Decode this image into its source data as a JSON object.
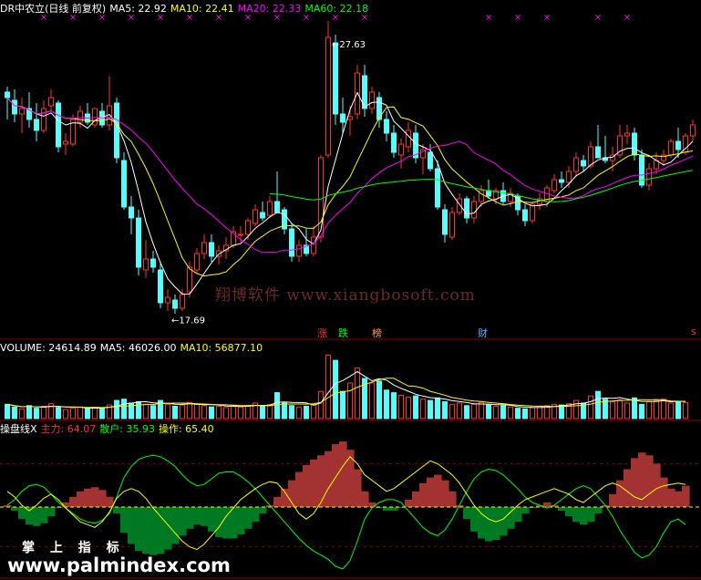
{
  "header": {
    "title": "DR中农立(日线 前复权)",
    "ma5": "MA5: 22.92",
    "ma10": "MA10: 22.41",
    "ma20": "MA20: 22.33",
    "ma60": "MA60: 22.18"
  },
  "volume_header": {
    "label": "VOLUME: 24614.89",
    "ma5": "MA5: 46026.00",
    "ma10": "MA10: 56877.10"
  },
  "indicator_header": {
    "label": "操盘线X",
    "main": "主力: 64.07",
    "retail": "散户: 35.93",
    "operate": "操作: 65.40"
  },
  "annotations": {
    "high": "27.63",
    "low": "17.69",
    "zhang": "涨",
    "die": "跌",
    "bang": "榜",
    "cai": "财",
    "s": "s"
  },
  "watermarks": {
    "center": "翔博软件 www.xiangbosoft.com",
    "brand": "掌 上 指 标",
    "site": "www.palmindex.com"
  },
  "colors": {
    "up": "#ff3232",
    "down": "#54ffff",
    "ma5": "#ffffff",
    "ma10": "#ffff00",
    "ma20": "#ff00ff",
    "ma60": "#00ff00",
    "retail_line": "#00ff00",
    "operate_line": "#ffff00",
    "main_fill_pos": "#a33232",
    "main_fill_neg": "#007a22"
  },
  "chart_data": [
    {
      "type": "candlestick",
      "title": "DR中农立(日线 前复权)",
      "ylim": [
        17,
        28.5
      ],
      "annotations": [
        {
          "label": "27.63",
          "value": 27.63
        },
        {
          "label": "17.69",
          "value": 17.69
        }
      ],
      "candles": [
        [
          25.8,
          26.0,
          24.8,
          25.6
        ],
        [
          25.5,
          25.9,
          24.7,
          25.0
        ],
        [
          25.0,
          25.6,
          24.3,
          25.2
        ],
        [
          25.2,
          25.8,
          24.5,
          24.8
        ],
        [
          24.8,
          25.4,
          24.0,
          24.4
        ],
        [
          24.4,
          25.5,
          24.3,
          25.2
        ],
        [
          25.3,
          25.9,
          25.1,
          25.6
        ],
        [
          25.4,
          25.5,
          23.6,
          23.8
        ],
        [
          23.9,
          24.3,
          23.5,
          24.0
        ],
        [
          23.9,
          25.0,
          23.8,
          24.8
        ],
        [
          24.7,
          25.3,
          24.5,
          25.1
        ],
        [
          25.0,
          25.4,
          24.6,
          24.7
        ],
        [
          24.6,
          25.2,
          24.5,
          25.2
        ],
        [
          25.1,
          25.4,
          24.5,
          24.6
        ],
        [
          24.6,
          26.4,
          24.4,
          25.3
        ],
        [
          25.4,
          25.6,
          23.2,
          23.4
        ],
        [
          23.3,
          23.6,
          21.5,
          21.6
        ],
        [
          21.6,
          22.0,
          20.6,
          21.2
        ],
        [
          21.2,
          21.5,
          19.1,
          19.4
        ],
        [
          19.3,
          20.4,
          19.0,
          19.7
        ],
        [
          19.7,
          20.0,
          19.2,
          19.4
        ],
        [
          19.3,
          19.6,
          17.9,
          18.1
        ],
        [
          18.1,
          18.6,
          17.8,
          18.3
        ],
        [
          18.2,
          18.4,
          17.7,
          17.9
        ],
        [
          17.9,
          18.6,
          17.8,
          18.4
        ],
        [
          18.5,
          19.6,
          18.3,
          19.4
        ],
        [
          19.3,
          20.1,
          19.2,
          19.9
        ],
        [
          19.9,
          20.6,
          19.7,
          20.3
        ],
        [
          20.3,
          20.6,
          19.6,
          19.8
        ],
        [
          19.8,
          20.2,
          19.5,
          20.0
        ],
        [
          20.0,
          20.5,
          19.7,
          20.2
        ],
        [
          20.2,
          20.9,
          20.1,
          20.7
        ],
        [
          20.6,
          20.9,
          20.3,
          20.6
        ],
        [
          20.6,
          21.2,
          20.4,
          21.1
        ],
        [
          21.0,
          21.7,
          20.9,
          21.5
        ],
        [
          21.4,
          21.8,
          21.1,
          21.2
        ],
        [
          21.3,
          22.0,
          21.2,
          21.8
        ],
        [
          21.8,
          22.9,
          21.5,
          21.4
        ],
        [
          21.5,
          21.6,
          20.6,
          20.8
        ],
        [
          20.8,
          21.0,
          19.6,
          19.8
        ],
        [
          19.8,
          20.4,
          19.6,
          20.2
        ],
        [
          20.2,
          20.8,
          19.8,
          19.9
        ],
        [
          19.9,
          20.9,
          19.8,
          20.5
        ],
        [
          20.5,
          23.5,
          20.3,
          23.4
        ],
        [
          23.5,
          28.4,
          23.4,
          27.8
        ],
        [
          27.6,
          27.9,
          24.6,
          25.0
        ],
        [
          25.0,
          25.6,
          24.3,
          24.7
        ],
        [
          24.8,
          25.3,
          24.2,
          24.9
        ],
        [
          25.0,
          26.8,
          24.8,
          26.5
        ],
        [
          26.4,
          26.8,
          24.9,
          25.2
        ],
        [
          25.2,
          26.0,
          25.0,
          25.8
        ],
        [
          25.6,
          25.8,
          24.5,
          24.8
        ],
        [
          24.8,
          25.1,
          24.0,
          24.3
        ],
        [
          24.3,
          24.6,
          23.4,
          23.6
        ],
        [
          23.5,
          24.1,
          23.0,
          23.9
        ],
        [
          23.8,
          24.7,
          23.6,
          24.4
        ],
        [
          24.3,
          24.6,
          23.2,
          23.4
        ],
        [
          23.4,
          23.9,
          22.8,
          23.7
        ],
        [
          23.6,
          23.9,
          22.9,
          23.0
        ],
        [
          23.0,
          23.3,
          21.5,
          21.6
        ],
        [
          21.5,
          21.7,
          20.3,
          20.6
        ],
        [
          20.5,
          21.6,
          20.4,
          21.4
        ],
        [
          21.4,
          22.1,
          21.3,
          21.9
        ],
        [
          21.9,
          22.0,
          21.0,
          21.2
        ],
        [
          21.2,
          22.0,
          21.0,
          21.8
        ],
        [
          21.8,
          22.4,
          21.6,
          22.2
        ],
        [
          22.2,
          22.6,
          21.9,
          22.0
        ],
        [
          21.9,
          22.3,
          21.7,
          22.2
        ],
        [
          22.2,
          22.5,
          21.7,
          21.8
        ],
        [
          21.8,
          22.3,
          21.6,
          22.1
        ],
        [
          22.0,
          22.1,
          21.3,
          21.5
        ],
        [
          21.5,
          21.7,
          20.9,
          21.1
        ],
        [
          21.1,
          21.8,
          21.0,
          21.7
        ],
        [
          21.7,
          22.1,
          21.5,
          21.9
        ],
        [
          21.8,
          22.4,
          21.6,
          22.3
        ],
        [
          22.2,
          22.8,
          22.1,
          22.6
        ],
        [
          22.6,
          22.9,
          22.3,
          22.5
        ],
        [
          22.5,
          23.1,
          22.3,
          22.9
        ],
        [
          22.9,
          23.6,
          22.7,
          23.4
        ],
        [
          23.3,
          23.5,
          22.9,
          23.1
        ],
        [
          23.1,
          24.0,
          23.0,
          23.8
        ],
        [
          23.8,
          24.6,
          23.6,
          23.4
        ],
        [
          23.4,
          24.2,
          23.2,
          23.3
        ],
        [
          23.3,
          23.8,
          22.9,
          23.5
        ],
        [
          23.5,
          24.6,
          23.4,
          24.2
        ],
        [
          24.2,
          24.6,
          23.9,
          24.3
        ],
        [
          24.3,
          24.5,
          23.3,
          23.5
        ],
        [
          23.5,
          23.7,
          22.3,
          22.4
        ],
        [
          22.4,
          23.2,
          22.2,
          23.0
        ],
        [
          23.0,
          23.6,
          22.8,
          23.3
        ],
        [
          23.3,
          23.7,
          23.1,
          23.5
        ],
        [
          23.5,
          24.1,
          23.4,
          24.0
        ],
        [
          24.0,
          24.5,
          23.4,
          23.7
        ],
        [
          23.6,
          24.3,
          23.5,
          24.2
        ],
        [
          24.2,
          24.8,
          24.0,
          24.6
        ]
      ]
    },
    {
      "type": "bar",
      "title": "VOLUME",
      "ylim": [
        0,
        100000
      ],
      "values": [
        22000,
        18000,
        15000,
        20000,
        16000,
        19000,
        23000,
        17000,
        14000,
        16000,
        18000,
        15000,
        17000,
        16000,
        21000,
        28000,
        30000,
        24000,
        26000,
        22000,
        20000,
        28000,
        22000,
        19000,
        21000,
        25000,
        23000,
        20000,
        18000,
        19000,
        17000,
        21000,
        18000,
        20000,
        24000,
        19000,
        22000,
        40000,
        24000,
        20000,
        18000,
        19000,
        22000,
        42000,
        98000,
        90000,
        42000,
        55000,
        78000,
        62000,
        55000,
        58000,
        44000,
        40000,
        36000,
        33000,
        35000,
        30000,
        28000,
        32000,
        26000,
        22000,
        24000,
        20000,
        22000,
        25000,
        21000,
        19000,
        20000,
        18000,
        16000,
        15000,
        17000,
        19000,
        20000,
        22000,
        21000,
        23000,
        28000,
        24000,
        35000,
        42000,
        30000,
        26000,
        29000,
        24000,
        32000,
        22000,
        26000,
        28000,
        30000,
        24000,
        26000,
        24614.89
      ],
      "ma5_last": 46026.0,
      "ma10_last": 56877.1
    },
    {
      "type": "line",
      "title": "操盘线X",
      "ylim": [
        0,
        100
      ],
      "series": [
        {
          "name": "主力",
          "values": [
            50,
            46,
            40,
            36,
            35,
            37,
            42,
            48,
            52,
            56,
            60,
            62,
            63,
            61,
            56,
            44,
            30,
            22,
            17,
            15,
            14,
            15,
            18,
            22,
            28,
            33,
            36,
            35,
            31,
            27,
            26,
            26,
            29,
            33,
            38,
            44,
            50,
            56,
            62,
            68,
            74,
            79,
            83,
            86,
            89,
            94,
            96,
            90,
            76,
            60,
            52,
            48,
            46,
            46,
            48,
            54,
            60,
            66,
            70,
            72,
            68,
            60,
            50,
            40,
            31,
            26,
            24,
            25,
            28,
            33,
            38,
            44,
            48,
            50,
            52,
            50,
            46,
            42,
            38,
            36,
            38,
            44,
            50,
            58,
            68,
            76,
            84,
            88,
            86,
            80,
            70,
            62,
            60,
            64
          ]
        },
        {
          "name": "散户",
          "values": [
            50,
            54,
            60,
            64,
            65,
            63,
            58,
            52,
            48,
            44,
            40,
            38,
            37,
            39,
            44,
            56,
            70,
            78,
            83,
            85,
            86,
            85,
            82,
            78,
            72,
            67,
            64,
            65,
            69,
            73,
            74,
            74,
            71,
            67,
            62,
            56,
            50,
            44,
            38,
            32,
            26,
            21,
            17,
            14,
            11,
            6,
            4,
            10,
            24,
            40,
            48,
            52,
            54,
            54,
            52,
            46,
            40,
            34,
            30,
            28,
            32,
            40,
            50,
            60,
            69,
            74,
            76,
            75,
            72,
            67,
            62,
            56,
            52,
            50,
            48,
            50,
            54,
            58,
            62,
            64,
            62,
            56,
            50,
            42,
            32,
            24,
            16,
            12,
            14,
            20,
            30,
            38,
            40,
            36
          ]
        },
        {
          "name": "操作",
          "values": [
            60,
            56,
            50,
            46,
            50,
            55,
            58,
            54,
            48,
            43,
            38,
            36,
            34,
            38,
            45,
            55,
            60,
            62,
            60,
            55,
            48,
            42,
            36,
            30,
            24,
            20,
            18,
            22,
            28,
            34,
            42,
            48,
            54,
            58,
            62,
            65,
            67,
            66,
            60,
            52,
            44,
            40,
            44,
            52,
            62,
            70,
            78,
            85,
            80,
            72,
            68,
            64,
            60,
            62,
            66,
            70,
            74,
            78,
            82,
            80,
            76,
            72,
            66,
            58,
            50,
            44,
            40,
            38,
            40,
            45,
            50,
            54,
            56,
            58,
            60,
            62,
            60,
            58,
            54,
            52,
            56,
            60,
            64,
            66,
            64,
            60,
            56,
            54,
            58,
            62,
            64,
            65,
            66,
            65
          ]
        }
      ]
    }
  ]
}
